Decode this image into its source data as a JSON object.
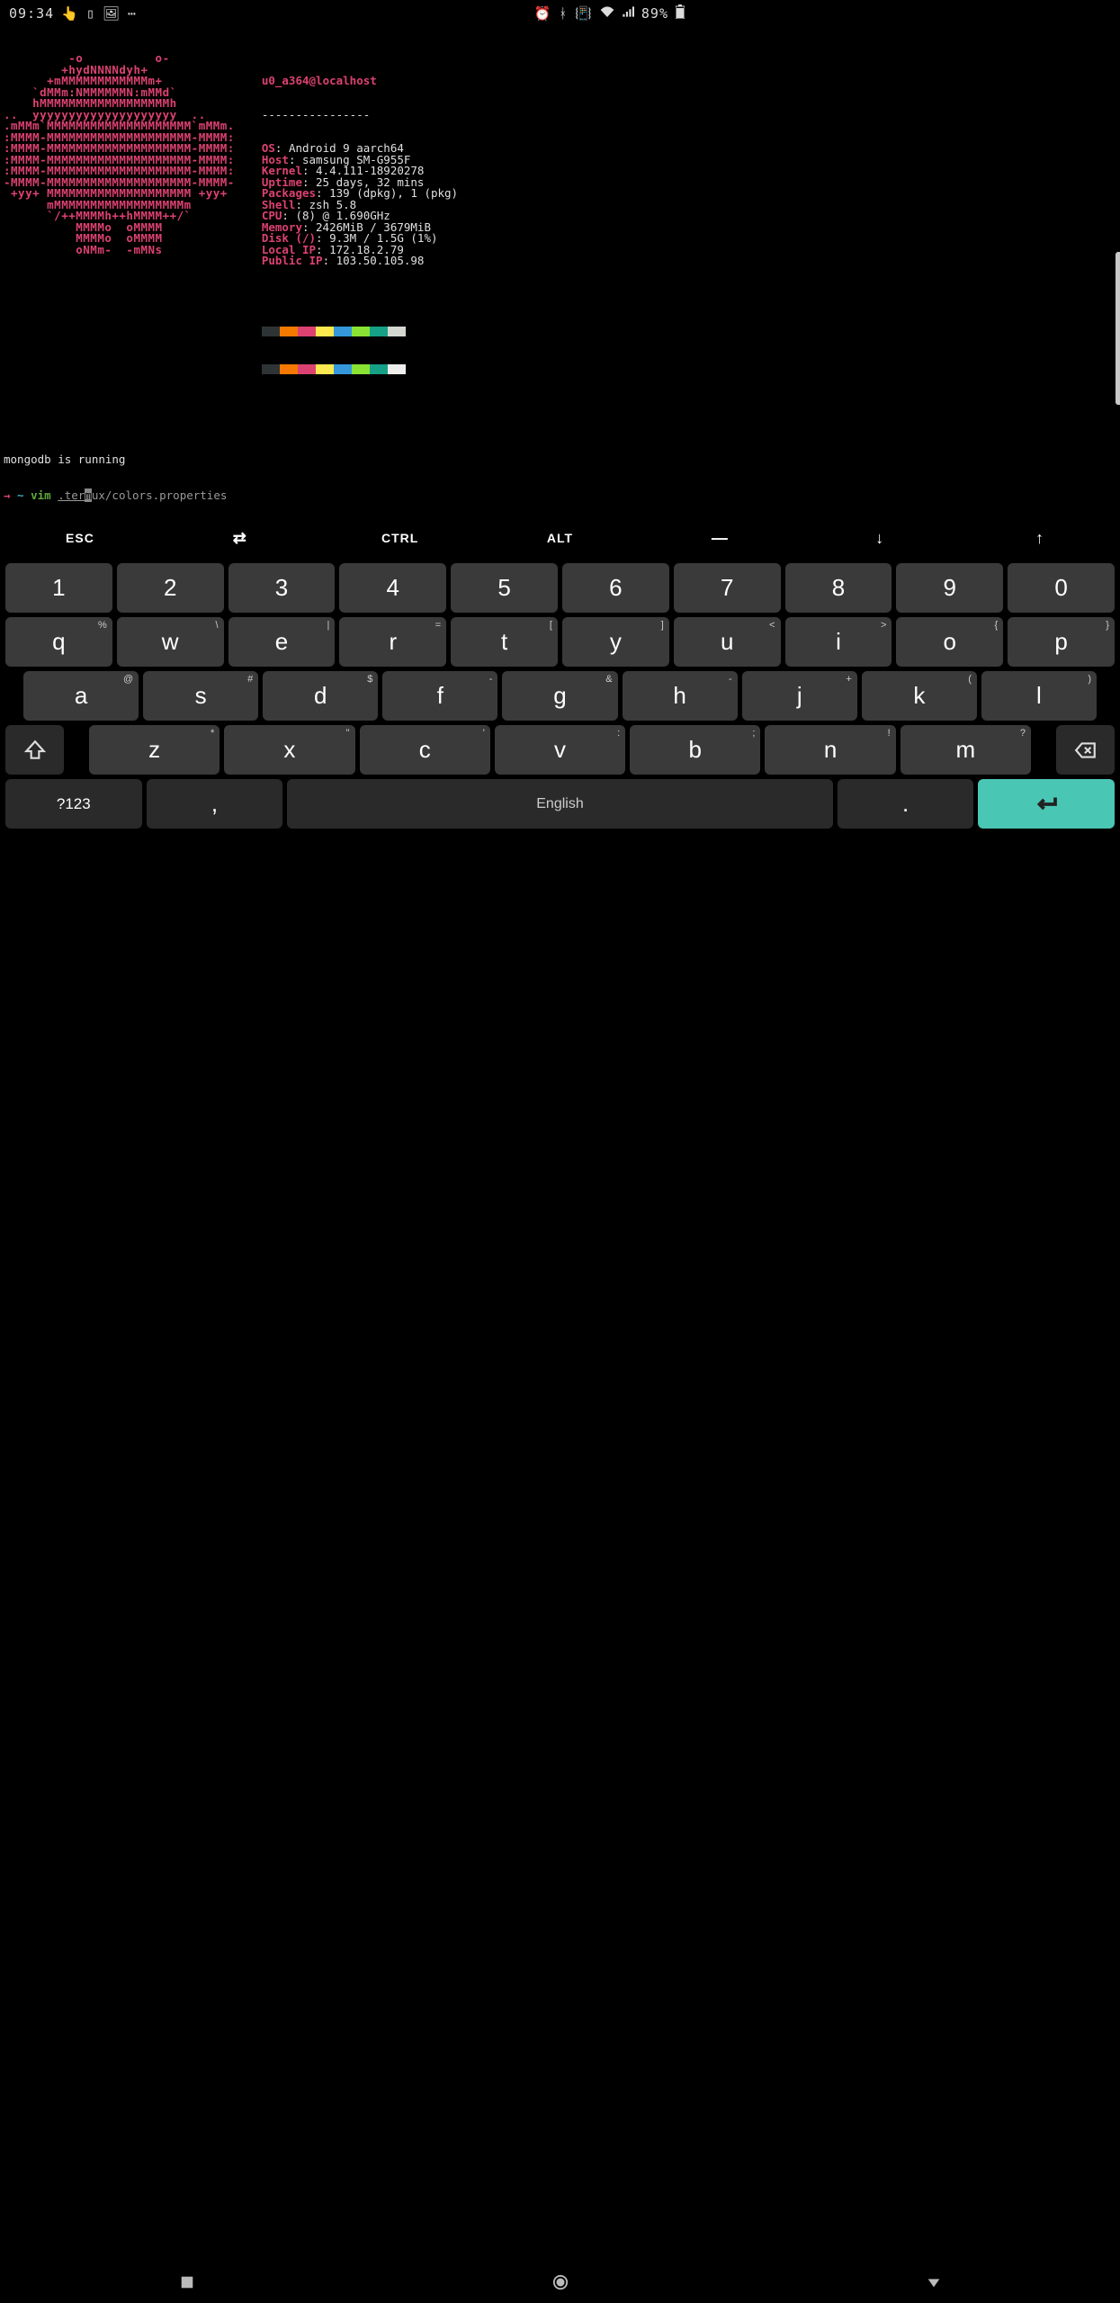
{
  "statusbar": {
    "time": "09:34",
    "battery": "89%"
  },
  "neofetch": {
    "user": "u0_a364",
    "at": "@",
    "host": "localhost",
    "sep": "----------------",
    "info": [
      {
        "k": "OS",
        "v": ": Android 9 aarch64"
      },
      {
        "k": "Host",
        "v": ": samsung SM-G955F"
      },
      {
        "k": "Kernel",
        "v": ": 4.4.111-18920278"
      },
      {
        "k": "Uptime",
        "v": ": 25 days, 32 mins"
      },
      {
        "k": "Packages",
        "v": ": 139 (dpkg), 1 (pkg)"
      },
      {
        "k": "Shell",
        "v": ": zsh 5.8"
      },
      {
        "k": "CPU",
        "v": ": (8) @ 1.690GHz"
      },
      {
        "k": "Memory",
        "v": ": 2426MiB / 3679MiB"
      },
      {
        "k": "Disk (/)",
        "v": ": 9.3M / 1.5G (1%)"
      },
      {
        "k": "Local IP",
        "v": ": 172.18.2.79"
      },
      {
        "k": "Public IP",
        "v": ": 103.50.105.98"
      }
    ],
    "palette": [
      "#2e3436",
      "#f57900",
      "#dc4271",
      "#fce94f",
      "#3498db",
      "#8ae234",
      "#16a085",
      "#d3d7cf",
      "#2e3436",
      "#f57900",
      "#dc4271",
      "#fce94f",
      "#3498db",
      "#8ae234",
      "#16a085",
      "#eeeeec"
    ],
    "ascii": "         -o          o-\n        +hydNNNNdyh+\n      +mMMMMMMMMMMMMm+\n    `dMMm:NMMMMMMN:mMMd`\n    hMMMMMMMMMMMMMMMMMMh\n..  yyyyyyyyyyyyyyyyyyyy  ..\n.mMMm`MMMMMMMMMMMMMMMMMMMM`mMMm.\n:MMMM-MMMMMMMMMMMMMMMMMMMM-MMMM:\n:MMMM-MMMMMMMMMMMMMMMMMMMM-MMMM:\n:MMMM-MMMMMMMMMMMMMMMMMMMM-MMMM:\n:MMMM-MMMMMMMMMMMMMMMMMMMM-MMMM:\n-MMMM-MMMMMMMMMMMMMMMMMMMM-MMMM-\n +yy+ MMMMMMMMMMMMMMMMMMMM +yy+\n      mMMMMMMMMMMMMMMMMMMm\n      `/++MMMMh++hMMMM++/`\n          MMMMo  oMMMM\n          MMMMo  oMMMM\n          oNMm-  -mMNs"
  },
  "terminal": {
    "line1": "mongodb is running",
    "prompt": {
      "arrow": "→",
      "tilde": " ~ ",
      "cmd": "vim ",
      "path_u": ".ter",
      "cursor": "m",
      "rest": "ux/colors.properties"
    }
  },
  "extrakeys": [
    "ESC",
    "⇄",
    "CTRL",
    "ALT",
    "—",
    "↓",
    "↑"
  ],
  "keyboard": {
    "row1": [
      "1",
      "2",
      "3",
      "4",
      "5",
      "6",
      "7",
      "8",
      "9",
      "0"
    ],
    "row2": [
      {
        "m": "q",
        "s": "%"
      },
      {
        "m": "w",
        "s": "\\"
      },
      {
        "m": "e",
        "s": "|"
      },
      {
        "m": "r",
        "s": "="
      },
      {
        "m": "t",
        "s": "["
      },
      {
        "m": "y",
        "s": "]"
      },
      {
        "m": "u",
        "s": "<"
      },
      {
        "m": "i",
        "s": ">"
      },
      {
        "m": "o",
        "s": "{"
      },
      {
        "m": "p",
        "s": "}"
      }
    ],
    "row3": [
      {
        "m": "a",
        "s": "@"
      },
      {
        "m": "s",
        "s": "#"
      },
      {
        "m": "d",
        "s": "$"
      },
      {
        "m": "f",
        "s": "-"
      },
      {
        "m": "g",
        "s": "&"
      },
      {
        "m": "h",
        "s": "-"
      },
      {
        "m": "j",
        "s": "+"
      },
      {
        "m": "k",
        "s": "("
      },
      {
        "m": "l",
        "s": ")"
      }
    ],
    "row4": [
      {
        "m": "z",
        "s": "*"
      },
      {
        "m": "x",
        "s": "\""
      },
      {
        "m": "c",
        "s": "'"
      },
      {
        "m": "v",
        "s": ":"
      },
      {
        "m": "b",
        "s": ";"
      },
      {
        "m": "n",
        "s": "!"
      },
      {
        "m": "m",
        "s": "?"
      }
    ],
    "lang": "?123",
    "comma": ",",
    "space": "English",
    "period": "."
  }
}
